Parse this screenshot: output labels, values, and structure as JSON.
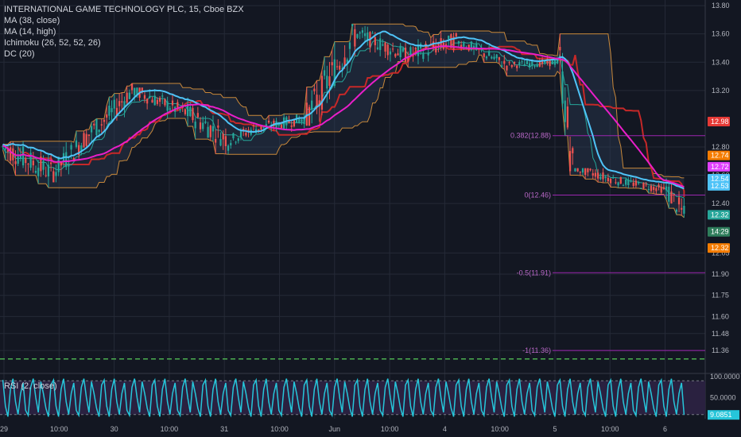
{
  "legend": {
    "title": "INTERNATIONAL GAME TECHNOLOGY PLC, 15, Cboe BZX",
    "items": [
      "MA (38, close)",
      "MA (14, high)",
      "Ichimoku (26, 52, 52, 26)",
      "DC (20)"
    ]
  },
  "rsi_legend": "RSI (2, close)",
  "colors": {
    "background": "#131722",
    "grid": "#252a37",
    "up": "#26a69a",
    "down": "#ef5350",
    "ma38": "#4fc3f7",
    "ma14": "#e91ec9",
    "dc": "#c8883a",
    "ichimoku_red": "#c62828",
    "ichimoku_teal": "#26a69a",
    "fib": "#9c27b0",
    "rsi": "#26c6da",
    "rsi_bg": "#2a2140"
  },
  "chart_data": {
    "type": "candlestick",
    "title": "INTERNATIONAL GAME TECHNOLOGY PLC, 15, Cboe BZX",
    "x_tick_labels": [
      "29",
      "10:00",
      "30",
      "10:00",
      "31",
      "10:00",
      "Jun",
      "10:00",
      "4",
      "10:00",
      "5",
      "10:00",
      "6"
    ],
    "y_tick_labels": [
      "13.80",
      "13.60",
      "13.40",
      "13.20",
      "12.80",
      "12.60",
      "12.40",
      "12.05",
      "11.90",
      "11.75",
      "11.60",
      "11.48",
      "11.36"
    ],
    "ylim": [
      11.22,
      13.84
    ],
    "price_tags": [
      {
        "label": "12.98",
        "value": 12.98,
        "color": "#e53935"
      },
      {
        "label": "12.74",
        "value": 12.74,
        "color": "#f57c00"
      },
      {
        "label": "12.72",
        "value": 12.66,
        "color": "#e040fb"
      },
      {
        "label": "12.54",
        "value": 12.575,
        "color": "#4fc3f7"
      },
      {
        "label": "12.53",
        "value": 12.525,
        "color": "#4fc3f7"
      },
      {
        "label": "12.32",
        "value": 12.32,
        "color": "#26a69a"
      },
      {
        "label": "14:29",
        "value": 12.2,
        "color": "#2e7d5b"
      },
      {
        "label": "12.32",
        "value": 12.085,
        "color": "#f57c00"
      }
    ],
    "fib_levels": [
      {
        "label": "0.382(12.88)",
        "value": 12.88
      },
      {
        "label": "0(12.46)",
        "value": 12.46
      },
      {
        "label": "-0.5(11.91)",
        "value": 11.91
      },
      {
        "label": "-1(11.36)",
        "value": 11.36
      }
    ],
    "dashed_level": 11.3,
    "rsi": {
      "name": "RSI (2, close)",
      "ylim": [
        0,
        100
      ],
      "levels": [
        90,
        10
      ],
      "tick_labels": [
        "100.0000",
        "50.0000",
        "9.0851"
      ],
      "last_value": 9.0851
    },
    "segments": [
      {
        "n": 20,
        "o": 12.8,
        "c": 12.62,
        "lo": 12.48,
        "hi": 12.95
      },
      {
        "n": 18,
        "o": 12.62,
        "c": 12.95,
        "lo": 12.55,
        "hi": 13.0
      },
      {
        "n": 14,
        "o": 12.95,
        "c": 13.2,
        "lo": 12.85,
        "hi": 13.25
      },
      {
        "n": 20,
        "o": 13.2,
        "c": 13.05,
        "lo": 12.9,
        "hi": 13.22
      },
      {
        "n": 18,
        "o": 13.05,
        "c": 12.85,
        "lo": 12.7,
        "hi": 13.15
      },
      {
        "n": 10,
        "o": 12.85,
        "c": 12.93,
        "lo": 12.75,
        "hi": 13.0
      },
      {
        "n": 20,
        "o": 12.93,
        "c": 13.0,
        "lo": 12.85,
        "hi": 13.08
      },
      {
        "n": 20,
        "o": 13.0,
        "c": 13.6,
        "lo": 12.95,
        "hi": 13.67
      },
      {
        "n": 20,
        "o": 13.6,
        "c": 13.45,
        "lo": 13.35,
        "hi": 13.67
      },
      {
        "n": 20,
        "o": 13.45,
        "c": 13.55,
        "lo": 13.3,
        "hi": 13.65
      },
      {
        "n": 20,
        "o": 13.55,
        "c": 13.38,
        "lo": 13.3,
        "hi": 13.55
      },
      {
        "n": 20,
        "o": 13.38,
        "c": 13.4,
        "lo": 13.3,
        "hi": 13.45
      },
      {
        "n": 6,
        "o": 13.4,
        "c": 12.65,
        "lo": 12.6,
        "hi": 13.6
      },
      {
        "n": 20,
        "o": 12.65,
        "c": 12.55,
        "lo": 12.46,
        "hi": 12.65
      },
      {
        "n": 16,
        "o": 12.55,
        "c": 12.5,
        "lo": 12.46,
        "hi": 12.62
      },
      {
        "n": 8,
        "o": 12.5,
        "c": 12.32,
        "lo": 12.3,
        "hi": 12.72
      }
    ],
    "rsi_pattern": [
      92,
      30,
      5,
      70,
      95,
      40,
      10,
      60,
      85,
      20,
      8,
      75,
      95,
      50,
      15,
      88,
      60,
      25,
      5,
      80
    ]
  }
}
